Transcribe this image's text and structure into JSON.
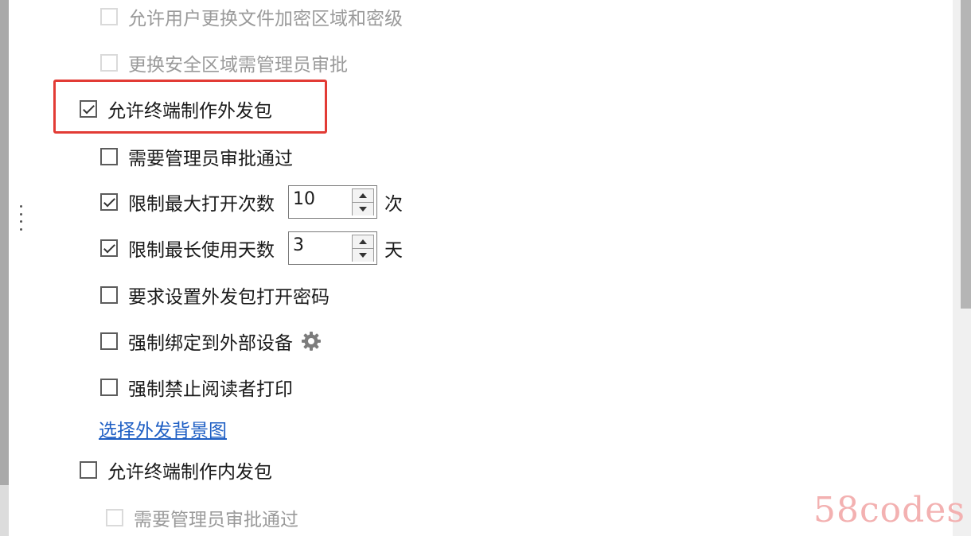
{
  "options": [
    {
      "label": "允许用户更换文件加密区域和密级",
      "checked": false,
      "disabled": true
    },
    {
      "label": "更换安全区域需管理员审批",
      "checked": false,
      "disabled": true
    },
    {
      "label": "允许终端制作外发包",
      "checked": true,
      "disabled": false
    },
    {
      "label": "需要管理员审批通过",
      "checked": false,
      "disabled": false
    },
    {
      "label": "限制最大打开次数",
      "checked": true,
      "disabled": false,
      "value": "10",
      "unit": "次"
    },
    {
      "label": "限制最长使用天数",
      "checked": true,
      "disabled": false,
      "value": "3",
      "unit": "天"
    },
    {
      "label": "要求设置外发包打开密码",
      "checked": false,
      "disabled": false
    },
    {
      "label": "强制绑定到外部设备",
      "checked": false,
      "disabled": false
    },
    {
      "label": "强制禁止阅读者打印",
      "checked": false,
      "disabled": false
    },
    {
      "label": "允许终端制作内发包",
      "checked": false,
      "disabled": false
    },
    {
      "label": "需要管理员审批通过",
      "checked": false,
      "disabled": true
    }
  ],
  "link": {
    "label": "选择外发背景图"
  },
  "watermark": "58codes",
  "colors": {
    "highlight": "#e23b35",
    "link": "#1f5fc4",
    "watermark": "#f3b1b1"
  },
  "icons": {
    "settings": "gear-icon",
    "more": "vertical-dots-icon"
  }
}
